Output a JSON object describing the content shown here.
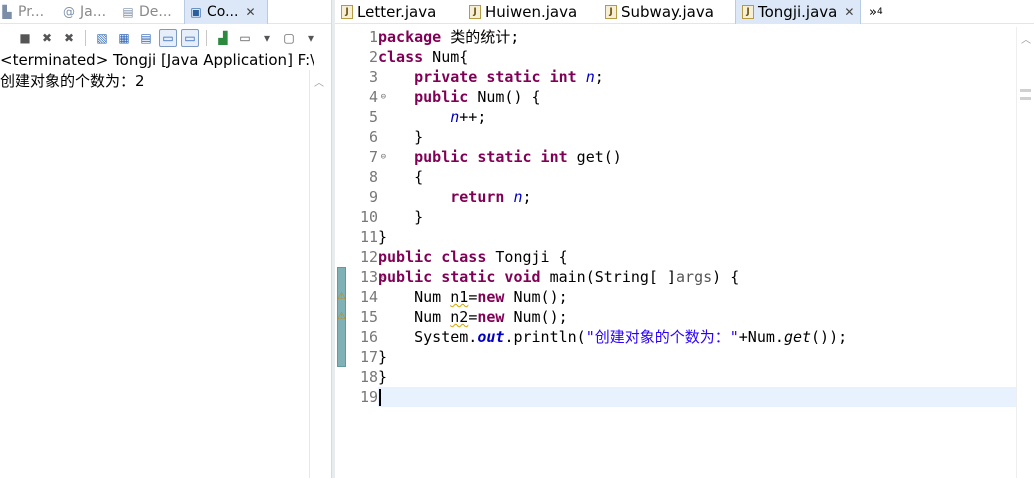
{
  "left_pane": {
    "tabs": [
      {
        "label": "Pr...",
        "icon": "package-explorer-icon"
      },
      {
        "label": "Ja...",
        "icon": "javadoc-icon"
      },
      {
        "label": "De...",
        "icon": "declaration-icon"
      },
      {
        "label": "Co...",
        "icon": "console-icon",
        "active": true
      }
    ],
    "close_glyph": "✕",
    "console": {
      "header": "<terminated> Tongji [Java Application] F:\\Java",
      "output_lines": [
        "创建对象的个数为：2"
      ]
    }
  },
  "editor": {
    "tabs": [
      {
        "label": "Letter.java"
      },
      {
        "label": "Huiwen.java"
      },
      {
        "label": "Subway.java"
      },
      {
        "label": "Tongji.java",
        "active": true
      }
    ],
    "more_tabs_label": "»",
    "more_tabs_count": "4",
    "line_numbers": [
      "1",
      "2",
      "3",
      "4",
      "5",
      "6",
      "7",
      "8",
      "9",
      "10",
      "11",
      "12",
      "13",
      "14",
      "15",
      "16",
      "17",
      "18",
      "19"
    ],
    "current_line": "19",
    "code": {
      "l1_kw": "package",
      "l1_rest": " 类的统计;",
      "l2_kw": "class",
      "l2_rest": " Num{",
      "l3_indent": "    ",
      "l3_kw": "private static int",
      "l3_sp": " ",
      "l3_field": "n",
      "l3_end": ";",
      "l4_indent": "    ",
      "l4_kw": "public",
      "l4_rest": " Num() {",
      "l5_indent": "        ",
      "l5_field": "n",
      "l5_rest": "++;",
      "l6_text": "    }",
      "l7_indent": "    ",
      "l7_kw": "public static int",
      "l7_rest": " get()",
      "l8_text": "    {",
      "l9_indent": "        ",
      "l9_kw": "return",
      "l9_sp": " ",
      "l9_field": "n",
      "l9_end": ";",
      "l10_text": "    }",
      "l11_text": "}",
      "l12_kw": "public class",
      "l12_rest": " Tongji {",
      "l13_kw": "public static void",
      "l13_rest": " main(String[ ]",
      "l13_args": "args",
      "l13_end": ") {",
      "l14_indent": "    ",
      "l14_a": "Num ",
      "l14_var": "n1",
      "l14_b": "=",
      "l14_kw": "new",
      "l14_c": " Num();",
      "l15_indent": "    ",
      "l15_a": "Num ",
      "l15_var": "n2",
      "l15_b": "=",
      "l15_kw": "new",
      "l15_c": " Num();",
      "l16_indent": "    ",
      "l16_a": "System.",
      "l16_out": "out",
      "l16_b": ".println(",
      "l16_str": "\"创建对象的个数为：\"",
      "l16_c": "+Num.",
      "l16_get": "get",
      "l16_d": "());",
      "l17_text": "}",
      "l18_text": "}",
      "l19_text": ""
    }
  }
}
